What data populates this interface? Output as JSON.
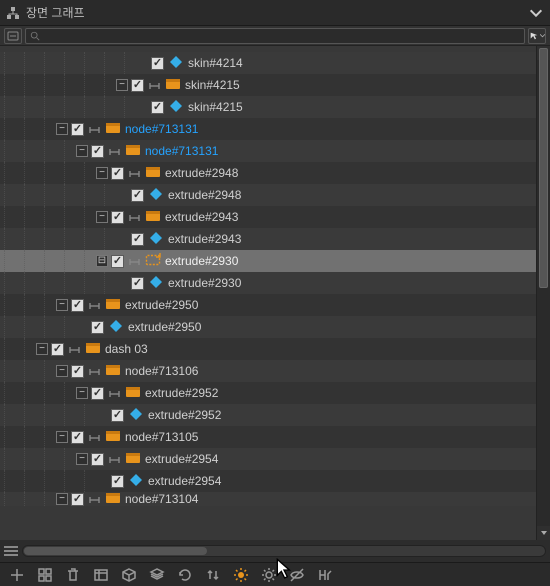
{
  "header": {
    "title": "장면 그래프"
  },
  "search": {
    "placeholder": ""
  },
  "tree": [
    {
      "depth": 7,
      "toggle": "none",
      "checked": true,
      "icon": "skin",
      "label": "skin#4214",
      "variant": ""
    },
    {
      "depth": 6,
      "toggle": "minus",
      "checked": true,
      "icon": "node",
      "cap": true,
      "label": "skin#4215",
      "variant": ""
    },
    {
      "depth": 7,
      "toggle": "none",
      "checked": true,
      "icon": "skin",
      "label": "skin#4215",
      "variant": ""
    },
    {
      "depth": 3,
      "toggle": "minus",
      "checked": true,
      "icon": "node",
      "cap": true,
      "label": "node#713131",
      "variant": "highlight"
    },
    {
      "depth": 4,
      "toggle": "minus",
      "checked": true,
      "icon": "node",
      "cap": true,
      "label": "node#713131",
      "variant": "highlight"
    },
    {
      "depth": 5,
      "toggle": "minus",
      "checked": true,
      "icon": "node",
      "cap": true,
      "label": "extrude#2948",
      "variant": ""
    },
    {
      "depth": 6,
      "toggle": "none",
      "checked": true,
      "icon": "skin",
      "label": "extrude#2948",
      "variant": ""
    },
    {
      "depth": 5,
      "toggle": "minus",
      "checked": true,
      "icon": "node",
      "cap": true,
      "label": "extrude#2943",
      "variant": ""
    },
    {
      "depth": 6,
      "toggle": "none",
      "checked": true,
      "icon": "skin",
      "label": "extrude#2943",
      "variant": ""
    },
    {
      "depth": 5,
      "toggle": "dotminus",
      "checked": true,
      "icon": "sel",
      "cap": true,
      "label": "extrude#2930",
      "variant": "sel"
    },
    {
      "depth": 6,
      "toggle": "none",
      "checked": true,
      "icon": "skin",
      "label": "extrude#2930",
      "variant": ""
    },
    {
      "depth": 3,
      "toggle": "minus",
      "checked": true,
      "icon": "node",
      "cap": true,
      "label": "extrude#2950",
      "variant": ""
    },
    {
      "depth": 4,
      "toggle": "none",
      "checked": true,
      "icon": "skin",
      "label": "extrude#2950",
      "variant": ""
    },
    {
      "depth": 2,
      "toggle": "minus",
      "checked": true,
      "icon": "node",
      "cap": true,
      "label": "dash 03",
      "variant": ""
    },
    {
      "depth": 3,
      "toggle": "minus",
      "checked": true,
      "icon": "node",
      "cap": true,
      "label": "node#713106",
      "variant": ""
    },
    {
      "depth": 4,
      "toggle": "minus",
      "checked": true,
      "icon": "node",
      "cap": true,
      "label": "extrude#2952",
      "variant": ""
    },
    {
      "depth": 5,
      "toggle": "none",
      "checked": true,
      "icon": "skin",
      "label": "extrude#2952",
      "variant": ""
    },
    {
      "depth": 3,
      "toggle": "minus",
      "checked": true,
      "icon": "node",
      "cap": true,
      "label": "node#713105",
      "variant": ""
    },
    {
      "depth": 4,
      "toggle": "minus",
      "checked": true,
      "icon": "node",
      "cap": true,
      "label": "extrude#2954",
      "variant": ""
    },
    {
      "depth": 5,
      "toggle": "none",
      "checked": true,
      "icon": "skin",
      "label": "extrude#2954",
      "variant": ""
    },
    {
      "depth": 3,
      "toggle": "minus",
      "checked": true,
      "icon": "node",
      "cap": true,
      "label": "node#713104",
      "variant": "cut"
    }
  ],
  "toolbar_icons": [
    "add",
    "grid4",
    "trash",
    "viewport",
    "cube",
    "stack",
    "refresh",
    "updown",
    "sun-full",
    "sun-dark",
    "eye-off",
    "hk"
  ]
}
